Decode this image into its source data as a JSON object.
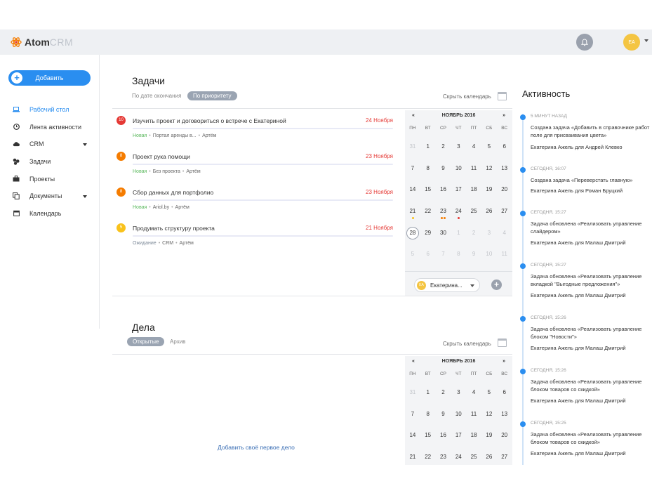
{
  "app": {
    "logo_atom": "Atom",
    "logo_crm": "CRM",
    "user_initials": "EA"
  },
  "sidebar": {
    "add_button": "Добавить",
    "items": [
      {
        "label": "Рабочий стол",
        "icon": "laptop-icon",
        "active": true
      },
      {
        "label": "Лента активности",
        "icon": "clock-icon"
      },
      {
        "label": "CRM",
        "icon": "cloud-icon",
        "has_caret": true
      },
      {
        "label": "Задачи",
        "icon": "tasks-icon"
      },
      {
        "label": "Проекты",
        "icon": "briefcase-icon"
      },
      {
        "label": "Документы",
        "icon": "documents-icon",
        "has_caret": true
      },
      {
        "label": "Календарь",
        "icon": "calendar-icon"
      }
    ]
  },
  "tasks_section": {
    "title": "Задачи",
    "filter_by_deadline": "По дате окончания",
    "filter_by_priority": "По приоритету",
    "hide_calendar": "Скрыть календарь",
    "items": [
      {
        "badge": "10",
        "badge_color": "#e53935",
        "title": "Изучить проект и договориться о встрече с Екатериной",
        "date": "24 Ноября",
        "status": "Новая",
        "project": "Портал аренды в...",
        "owner": "Артём"
      },
      {
        "badge": "8",
        "badge_color": "#f57c00",
        "title": "Проект рука помощи",
        "date": "23 Ноября",
        "status": "Новая",
        "project": "Без проекта",
        "owner": "Артём"
      },
      {
        "badge": "8",
        "badge_color": "#f57c00",
        "title": "Сбор данных для портфолио",
        "date": "23 Ноября",
        "status": "Новая",
        "project": "Ariol.by",
        "owner": "Артём"
      },
      {
        "badge": "5",
        "badge_color": "#f9c21b",
        "title": "Продумать структуру проекта",
        "date": "21 Ноября",
        "status": "Ожидание",
        "project": "CRM",
        "owner": "Артём"
      }
    ]
  },
  "calendar": {
    "prev": "«",
    "next": "»",
    "month": "НОЯБРЬ 2016",
    "weekdays": [
      "ПН",
      "ВТ",
      "СР",
      "ЧТ",
      "ПТ",
      "СБ",
      "ВС"
    ],
    "rows": [
      [
        "31",
        "1",
        "2",
        "3",
        "4",
        "5",
        "6"
      ],
      [
        "7",
        "8",
        "9",
        "10",
        "11",
        "12",
        "13"
      ],
      [
        "14",
        "15",
        "16",
        "17",
        "18",
        "19",
        "20"
      ],
      [
        "21",
        "22",
        "23",
        "24",
        "25",
        "26",
        "27"
      ],
      [
        "28",
        "29",
        "30",
        "1",
        "2",
        "3",
        "4"
      ],
      [
        "5",
        "6",
        "7",
        "8",
        "9",
        "10",
        "11"
      ]
    ],
    "user_initials": "EA",
    "user_name": "Екатерина...",
    "add": "+"
  },
  "deals_section": {
    "title": "Дела",
    "tab_open": "Открытые",
    "tab_archive": "Архив",
    "hide_calendar": "Скрыть календарь",
    "empty_link": "Добавить своё первое дело",
    "calendar_rows": [
      [
        "31",
        "1",
        "2",
        "3",
        "4",
        "5",
        "6"
      ],
      [
        "7",
        "8",
        "9",
        "10",
        "11",
        "12",
        "13"
      ],
      [
        "14",
        "15",
        "16",
        "17",
        "18",
        "19",
        "20"
      ],
      [
        "21",
        "22",
        "23",
        "24",
        "25",
        "26",
        "27"
      ]
    ]
  },
  "activity": {
    "title": "Активность",
    "items": [
      {
        "time": "5 минут назад",
        "action": "Создана задача «Добавить в справочнике работ поле для присваивания цвета»",
        "author": "Екатерина Ажель",
        "for": "для",
        "target": "Андрей Клевко"
      },
      {
        "time": "Сегодня, 16:07",
        "action": "Создана задача «Переверстать главную»",
        "author": "Екатерина Ажель",
        "for": "для",
        "target": "Роман Бруцкий"
      },
      {
        "time": "Сегодня, 15:27",
        "action": "Задача обновлена «Реализовать управление слайдером»",
        "author": "Екатерина Ажель",
        "for": "для",
        "target": "Малаш Дмитрий"
      },
      {
        "time": "Сегодня, 15:27",
        "action": "Задача обновлена «Реализовать управление вкладкой \"Выгодные предложения\"»",
        "author": "Екатерина Ажель",
        "for": "для",
        "target": "Малаш Дмитрий"
      },
      {
        "time": "Сегодня, 15:26",
        "action": "Задача обновлена «Реализовать управление блоком \"Новости\"»",
        "author": "Екатерина Ажель",
        "for": "для",
        "target": "Малаш Дмитрий"
      },
      {
        "time": "Сегодня, 15:26",
        "action": "Задача обновлена «Реализовать управление блоком товаров со скидкой»",
        "author": "Екатерина Ажель",
        "for": "для",
        "target": "Малаш Дмитрий"
      },
      {
        "time": "Сегодня, 15:25",
        "action": "Задача обновлена «Реализовать управление блоком товаров со скидкой»",
        "author": "Екатерина Ажель",
        "for": "для",
        "target": "Малаш Дмитрий"
      }
    ]
  },
  "colors": {
    "accent": "#2a8ef0",
    "danger": "#e53935"
  }
}
